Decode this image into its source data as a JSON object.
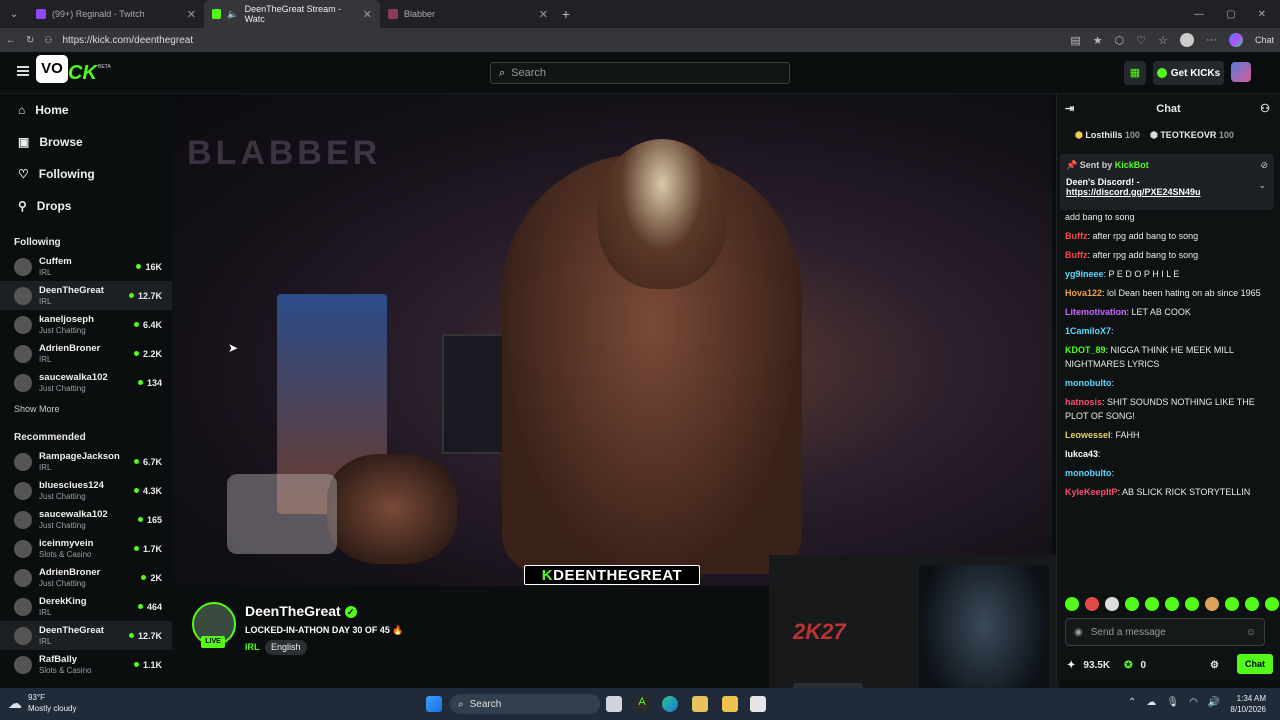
{
  "browser": {
    "tabs": [
      {
        "label": "(99+) Reginald - Twitch",
        "active": false
      },
      {
        "label": "DeenTheGreat Stream - Watc",
        "active": true
      },
      {
        "label": "Blabber",
        "active": false
      }
    ],
    "url": "https://kick.com/deenthegreat",
    "profile_chat_label": "Chat"
  },
  "kick": {
    "search_placeholder": "Search",
    "get_kicks_label": "Get KICKs",
    "beta_label": "BETA"
  },
  "sidebar": {
    "nav": [
      {
        "label": "Home",
        "icon": "home-icon"
      },
      {
        "label": "Browse",
        "icon": "browse-icon"
      },
      {
        "label": "Following",
        "icon": "heart-icon"
      },
      {
        "label": "Drops",
        "icon": "drops-icon"
      }
    ],
    "following_header": "Following",
    "following": [
      {
        "name": "Cuffem",
        "category": "IRL",
        "viewers": "16K"
      },
      {
        "name": "DeenTheGreat",
        "category": "IRL",
        "viewers": "12.7K",
        "selected": true
      },
      {
        "name": "kaneljoseph",
        "category": "Just Chatting",
        "viewers": "6.4K"
      },
      {
        "name": "AdrienBroner",
        "category": "IRL",
        "viewers": "2.2K"
      },
      {
        "name": "saucewalka102",
        "category": "Just Chatting",
        "viewers": "134"
      }
    ],
    "show_more": "Show More",
    "recommended_header": "Recommended",
    "recommended": [
      {
        "name": "RampageJackson",
        "category": "IRL",
        "viewers": "6.7K"
      },
      {
        "name": "bluesclues124",
        "category": "Just Chatting",
        "viewers": "4.3K"
      },
      {
        "name": "saucewalka102",
        "category": "Just Chatting",
        "viewers": "165"
      },
      {
        "name": "iceinmyvein",
        "category": "Slots & Casino",
        "viewers": "1.7K"
      },
      {
        "name": "AdrienBroner",
        "category": "Just Chatting",
        "viewers": "2K"
      },
      {
        "name": "DerekKing",
        "category": "IRL",
        "viewers": "464"
      },
      {
        "name": "DeenTheGreat",
        "category": "IRL",
        "viewers": "12.7K",
        "selected": true
      },
      {
        "name": "RafBally",
        "category": "Slots & Casino",
        "viewers": "1.1K"
      }
    ]
  },
  "video": {
    "overlay_prefix": "K",
    "overlay_text": "DEENTHEGREAT"
  },
  "streamer": {
    "name": "DeenTheGreat",
    "title": "LOCKED-IN-ATHON DAY 30 OF 45 🔥",
    "category": "IRL",
    "language": "English",
    "live_label": "LIVE"
  },
  "pip": {
    "game_logo": "2K27"
  },
  "chat": {
    "header": "Chat",
    "leaderboard": [
      {
        "name": "Losthills",
        "value": "100"
      },
      {
        "name": "TEOTKEOVR",
        "value": "100"
      }
    ],
    "pinned": {
      "sent_by_label": "Sent by",
      "sender": "KickBot",
      "text": "Deen's Discord! -",
      "link": "https://discord.gg/PXE24SN49u"
    },
    "messages": [
      {
        "user": "",
        "color": "#eaeaea",
        "text": "add bang to song"
      },
      {
        "user": "Buffz",
        "color": "#ff4444",
        "text": "after rpg add bang to song"
      },
      {
        "user": "Buffz",
        "color": "#ff4444",
        "text": "after rpg add bang to song"
      },
      {
        "user": "yg9ineee",
        "color": "#5ad8ff",
        "text": "P E D O P H I L E"
      },
      {
        "user": "Hova122",
        "color": "#f2a23a",
        "text": "lol Dean been hating on ab since 1965"
      },
      {
        "user": "Litemotivation",
        "color": "#c56bff",
        "text": "LET AB COOK"
      },
      {
        "user": "1CamiloX7",
        "color": "#5ad8ff",
        "text": ""
      },
      {
        "user": "KDOT_89",
        "color": "#53fc18",
        "text": "NIGGA THINK HE MEEK MILL NIGHTMARES LYRICS"
      },
      {
        "user": "monobulto",
        "color": "#5ad8ff",
        "text": ""
      },
      {
        "user": "hatnosis",
        "color": "#ff4b6e",
        "text": "SHIT SOUNDS NOTHING LIKE THE PLOT OF SONG!"
      },
      {
        "user": "Leowessel",
        "color": "#e8d36a",
        "text": "FAHH"
      },
      {
        "user": "lukca43",
        "color": "#ffffff",
        "text": ""
      },
      {
        "user": "monobulto",
        "color": "#5ad8ff",
        "text": ""
      },
      {
        "user": "KyleKeepItP",
        "color": "#ff4b6e",
        "text": "AB SLICK RICK STORYTELLIN"
      }
    ],
    "send_placeholder": "Send a message",
    "kicks_balance": "93.5K",
    "points": "0",
    "chat_button": "Chat"
  },
  "taskbar": {
    "temperature": "93°F",
    "weather": "Mostly cloudy",
    "search": "Search",
    "time": "1:34 AM",
    "date": "8/10/2026"
  }
}
